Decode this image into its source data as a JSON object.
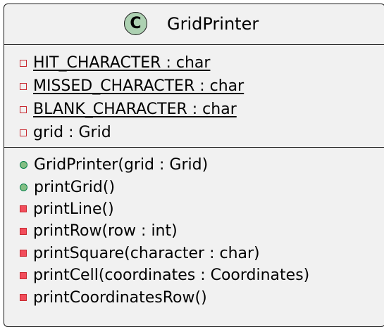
{
  "class": {
    "stereotype_letter": "C",
    "name": "GridPrinter"
  },
  "fields": [
    {
      "text": "HIT_CHARACTER : char",
      "visibility": "private",
      "static": true
    },
    {
      "text": "MISSED_CHARACTER : char",
      "visibility": "private",
      "static": true
    },
    {
      "text": "BLANK_CHARACTER : char",
      "visibility": "private",
      "static": true
    },
    {
      "text": "grid : Grid",
      "visibility": "private",
      "static": false
    }
  ],
  "methods": [
    {
      "text": "GridPrinter(grid : Grid)",
      "visibility": "public"
    },
    {
      "text": "printGrid()",
      "visibility": "public"
    },
    {
      "text": "printLine()",
      "visibility": "private"
    },
    {
      "text": "printRow(row : int)",
      "visibility": "private"
    },
    {
      "text": "printSquare(character : char)",
      "visibility": "private"
    },
    {
      "text": "printCell(coordinates : Coordinates)",
      "visibility": "private"
    },
    {
      "text": "printCoordinatesRow()",
      "visibility": "private"
    }
  ],
  "colors": {
    "class_background": "#f1f1f1",
    "border": "#181818",
    "stereotype_circle": "#add1b2",
    "private_marker_border": "#c82930",
    "private_marker_fill": "#f24d5c",
    "public_marker_border": "#038048",
    "public_marker_fill": "#84be84"
  }
}
